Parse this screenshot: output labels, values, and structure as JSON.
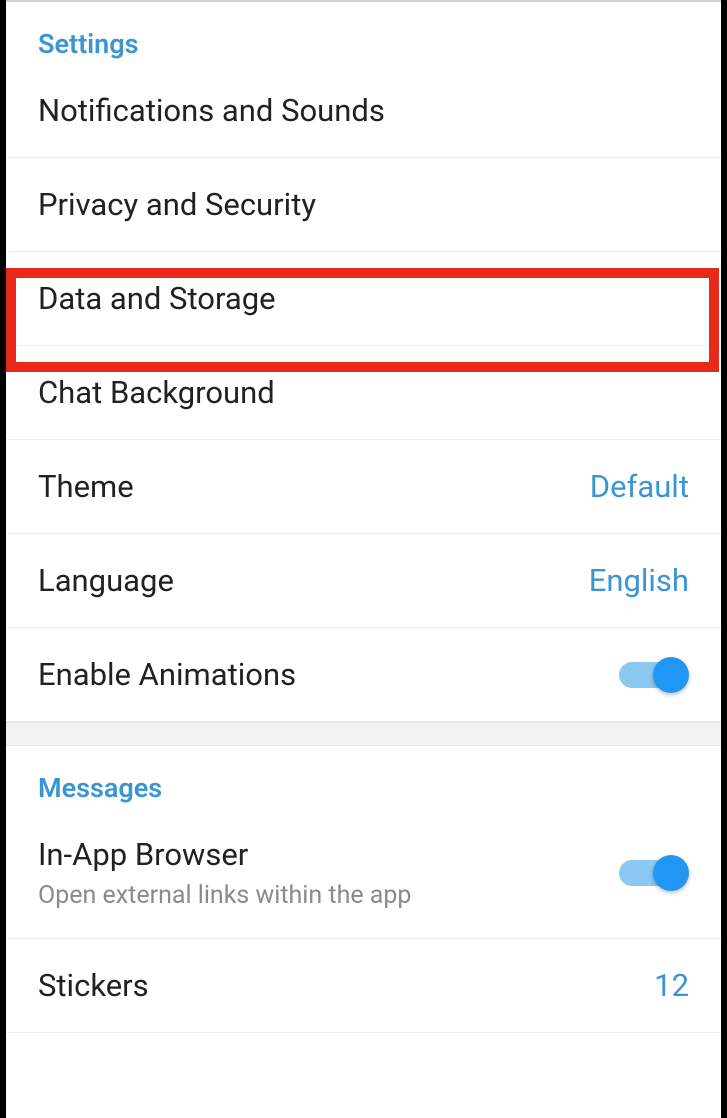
{
  "settings": {
    "header": "Settings",
    "items": {
      "notifications": "Notifications and Sounds",
      "privacy": "Privacy and Security",
      "data_storage": "Data and Storage",
      "chat_background": "Chat Background",
      "theme": {
        "label": "Theme",
        "value": "Default"
      },
      "language": {
        "label": "Language",
        "value": "English"
      },
      "animations": {
        "label": "Enable Animations",
        "enabled": true
      }
    }
  },
  "messages": {
    "header": "Messages",
    "items": {
      "in_app_browser": {
        "label": "In-App Browser",
        "subtitle": "Open external links within the app",
        "enabled": true
      },
      "stickers": {
        "label": "Stickers",
        "value": "12"
      }
    }
  }
}
